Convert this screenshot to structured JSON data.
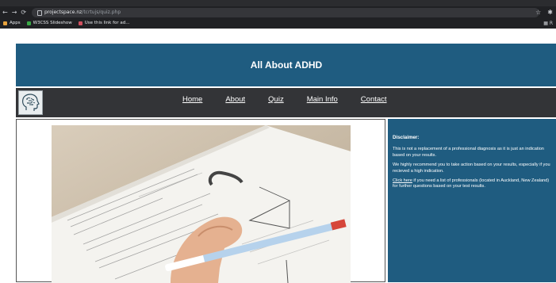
{
  "browser": {
    "url_host": "projectspace.nz",
    "url_path": "/tcrtujs/quiz.php",
    "bookmarks": [
      {
        "label": "Apps",
        "color": "#e8a33d"
      },
      {
        "label": "W3CSS Slideshow",
        "color": "#39a845"
      },
      {
        "label": "Use this link for ad...",
        "color": "#d1505f"
      }
    ],
    "bookmarks_right": "R"
  },
  "site": {
    "title": "All About ADHD",
    "nav": [
      "Home",
      "About",
      "Quiz",
      "Main Info",
      "Contact"
    ],
    "disclaimer": {
      "title": "Disclaimer:",
      "p1": "This is not a replacement of a professional diagnosis as it is just an indication based on your results.",
      "p2": "We highly recommend you to take action based on your results, especially if you recieved a high indication.",
      "link": "Click here",
      "p3_rest": " if you need a list of professionals (located in Auckland, New Zealand) for further questions based on your test results."
    }
  },
  "colors": {
    "banner": "#1f5c80",
    "navbar": "#333437",
    "sidebar": "#1f5c80"
  }
}
